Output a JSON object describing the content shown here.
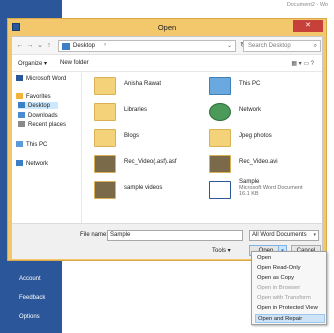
{
  "word": {
    "doc_title": "Document2 - Wo",
    "backstage": [
      "Account",
      "Feedback",
      "Options"
    ]
  },
  "dialog": {
    "title": "Open",
    "close": "✕",
    "address": {
      "location": "Desktop",
      "chevron": "›",
      "dropdown": "⌄"
    },
    "search_placeholder": "Search Desktop",
    "toolbar": {
      "organize": "Organize ▾",
      "new_folder": "New folder"
    },
    "nav_pane": [
      {
        "label": "Microsoft Word",
        "icon": "word-icon"
      },
      {
        "label": "Favorites",
        "icon": "star-icon"
      },
      {
        "label": "Desktop",
        "icon": "desktop-icon",
        "selected": true
      },
      {
        "label": "Downloads",
        "icon": "download-icon"
      },
      {
        "label": "Recent places",
        "icon": "recent-icon"
      },
      {
        "label": "This PC",
        "icon": "pc-icon"
      },
      {
        "label": "Network",
        "icon": "network-icon"
      }
    ],
    "files": [
      {
        "name": "Anisha Rawat",
        "icon": "user-folder-icon"
      },
      {
        "name": "This PC",
        "icon": "pc-icon"
      },
      {
        "name": "Libraries",
        "icon": "library-icon"
      },
      {
        "name": "Network",
        "icon": "network-icon"
      },
      {
        "name": "Blogs",
        "icon": "folder-icon"
      },
      {
        "name": "Jpeg photos",
        "icon": "folder-icon"
      },
      {
        "name": "Rec_Video(.asf).asf",
        "icon": "video-file-icon"
      },
      {
        "name": "Rec_Video.avi",
        "icon": "video-file-icon"
      },
      {
        "name": "sample videos",
        "icon": "folder-icon"
      },
      {
        "name": "Sample",
        "icon": "word-document-icon",
        "type": "Microsoft Word Document",
        "size": "16.1 KB"
      }
    ],
    "bottom": {
      "file_name_label": "File name:",
      "file_name_value": "Sample",
      "file_type": "All Word Documents",
      "tools": "Tools ▾",
      "open": "Open",
      "cancel": "Cancel"
    },
    "open_menu": [
      {
        "label": "Open",
        "enabled": true
      },
      {
        "label": "Open Read-Only",
        "enabled": true
      },
      {
        "label": "Open as Copy",
        "enabled": true
      },
      {
        "label": "Open in Browser",
        "enabled": false
      },
      {
        "label": "Open with Transform",
        "enabled": false
      },
      {
        "label": "Open in Protected View",
        "enabled": true
      },
      {
        "label": "Open and Repair",
        "enabled": true,
        "selected": true
      }
    ]
  }
}
